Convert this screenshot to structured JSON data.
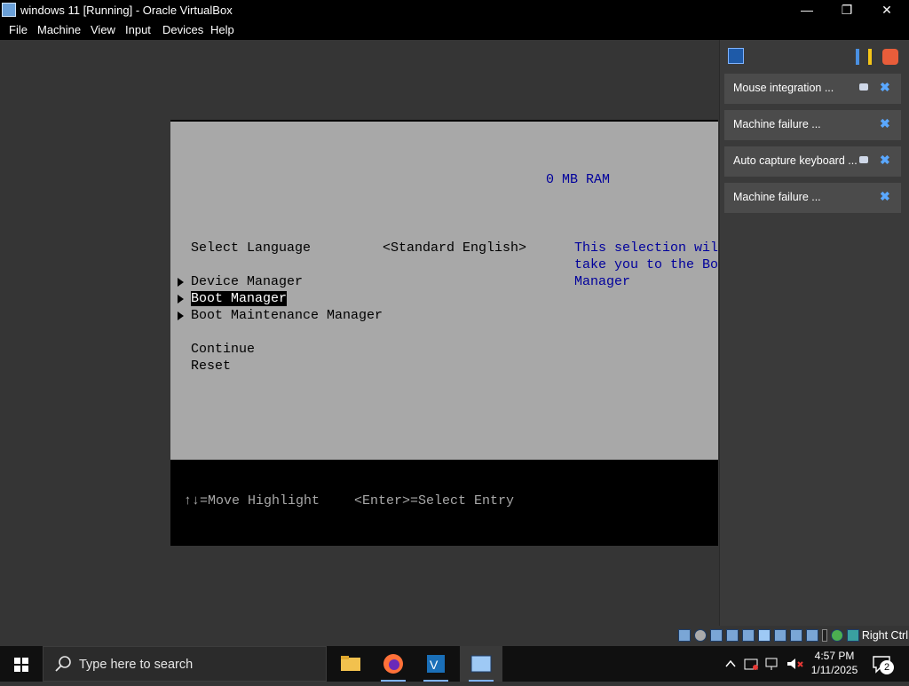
{
  "window": {
    "title": "windows 11 [Running] - Oracle VirtualBox",
    "minimize_glyph": "—",
    "restore_glyph": "❐",
    "close_glyph": "✕"
  },
  "menu": [
    "File",
    "Machine",
    "View",
    "Input",
    "Devices",
    "Help"
  ],
  "bios": {
    "ram": "0 MB RAM",
    "select_language_label": "Select Language",
    "language_value": "<Standard English>",
    "help_lines": [
      "This selection will",
      "take you to the Boot",
      "Manager"
    ],
    "menu_items": [
      "Device Manager",
      "Boot Manager",
      "Boot Maintenance Manager"
    ],
    "actions": [
      "Continue",
      "Reset"
    ],
    "footer_move": "↑↓=Move Highlight",
    "footer_select": "<Enter>=Select Entry"
  },
  "notifications": [
    {
      "text": "Mouse integration ...",
      "pinned": true
    },
    {
      "text": "Machine failure ...",
      "pinned": false
    },
    {
      "text": "Auto capture keyboard ...",
      "pinned": true
    },
    {
      "text": "Machine failure ...",
      "pinned": false
    }
  ],
  "notif_close_glyph": "✖",
  "statusbar": {
    "host_key": "Right Ctrl"
  },
  "taskbar": {
    "search_placeholder": "Type here to search",
    "time": "4:57 PM",
    "date": "1/11/2025",
    "notification_count": "2"
  },
  "colors": {
    "bios_bg": "#a8a8a8",
    "bios_help": "#00009c",
    "accent": "#5aa8ff"
  }
}
